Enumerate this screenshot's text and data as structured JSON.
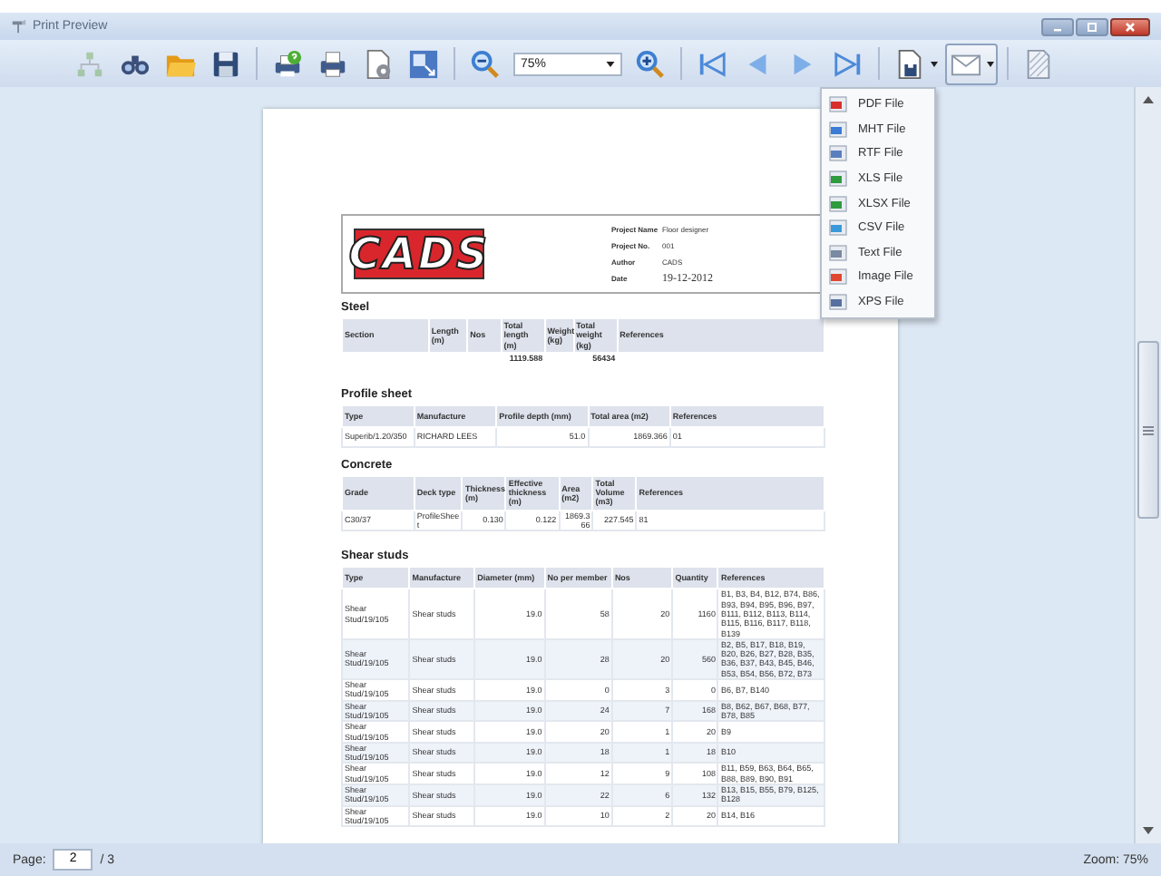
{
  "window": {
    "title": "Print Preview"
  },
  "toolbar": {
    "buttons": [
      {
        "kind": "tree",
        "disabled": true,
        "pressed": false
      },
      {
        "kind": "binoculars",
        "disabled": false,
        "pressed": false
      },
      {
        "kind": "folder",
        "disabled": false,
        "pressed": false
      },
      {
        "kind": "disk",
        "disabled": false,
        "pressed": false
      },
      {
        "kind": "separator"
      },
      {
        "kind": "printer-help",
        "disabled": false,
        "pressed": false
      },
      {
        "kind": "printer",
        "disabled": false,
        "pressed": false
      },
      {
        "kind": "page-gear",
        "disabled": false,
        "pressed": false
      },
      {
        "kind": "resize",
        "disabled": false,
        "pressed": false
      },
      {
        "kind": "separator"
      },
      {
        "kind": "zoom-out",
        "disabled": false,
        "pressed": false
      },
      {
        "kind": "zoom-select",
        "value": "75%"
      },
      {
        "kind": "zoom-in",
        "disabled": false,
        "pressed": false
      },
      {
        "kind": "separator"
      },
      {
        "kind": "first",
        "disabled": false,
        "pressed": false
      },
      {
        "kind": "prev",
        "disabled": false,
        "pressed": false
      },
      {
        "kind": "next",
        "disabled": false,
        "pressed": false
      },
      {
        "kind": "last",
        "disabled": false,
        "pressed": false
      },
      {
        "kind": "separator"
      },
      {
        "kind": "save-page",
        "disabled": false,
        "pressed": false,
        "dropdown": true
      },
      {
        "kind": "envelope",
        "disabled": false,
        "pressed": true,
        "dropdown": true
      },
      {
        "kind": "separator"
      },
      {
        "kind": "watermark",
        "disabled": false,
        "pressed": false
      }
    ]
  },
  "export_menu": [
    {
      "label": "PDF File",
      "kind": "pdf"
    },
    {
      "label": "MHT File",
      "kind": "mht"
    },
    {
      "label": "RTF File",
      "kind": "rtf"
    },
    {
      "label": "XLS File",
      "kind": "xls"
    },
    {
      "label": "XLSX File",
      "kind": "xlsx"
    },
    {
      "label": "CSV File",
      "kind": "csv"
    },
    {
      "label": "Text File",
      "kind": "txt"
    },
    {
      "label": "Image File",
      "kind": "image"
    },
    {
      "label": "XPS File",
      "kind": "xps"
    }
  ],
  "report": {
    "logo": "CADS",
    "info": [
      {
        "label": "Project Name",
        "value": "Floor designer"
      },
      {
        "label": "Project No.",
        "value": "001"
      },
      {
        "label": "Author",
        "value": "CADS"
      },
      {
        "label": "Date",
        "value": "19-12-2012",
        "kind": "date"
      }
    ],
    "sections": [
      {
        "title": "Steel",
        "columns": [
          "Section",
          "Length (m)",
          "Nos",
          "Total length (m)",
          "Weight (kg)",
          "Total weight (kg)",
          "References"
        ],
        "total_row": true,
        "rows": [
          [
            "",
            "",
            "",
            "1119.588",
            "",
            "56434",
            ""
          ]
        ]
      },
      {
        "title": "Profile sheet",
        "columns": [
          "Type",
          "Manufacture",
          "Profile depth (mm)",
          "Total area (m2)",
          "References"
        ],
        "rows": [
          [
            "Superib/1.20/350",
            "RICHARD LEES",
            "51.0",
            "1869.366",
            "01"
          ]
        ]
      },
      {
        "title": "Concrete",
        "columns": [
          "Grade",
          "Deck type",
          "Thickness (m)",
          "Effective thickness (m)",
          "Area (m2)",
          "Total Volume (m3)",
          "References"
        ],
        "rows": [
          [
            "C30/37",
            "ProfileSheet",
            "0.130",
            "0.122",
            "1869.366",
            "227.545",
            "81"
          ]
        ]
      },
      {
        "title": "Shear studs",
        "columns": [
          "Type",
          "Manufacture",
          "Diameter (mm)",
          "No per member",
          "Nos",
          "Quantity",
          "References"
        ],
        "rows": [
          [
            "Shear Stud/19/105",
            "Shear studs",
            "19.0",
            "58",
            "20",
            "1160",
            "B1, B3, B4, B12, B74, B86, B93, B94, B95, B96, B97, B111, B112, B113, B114, B115, B116, B117, B118, B139"
          ],
          [
            "Shear Stud/19/105",
            "Shear studs",
            "19.0",
            "28",
            "20",
            "560",
            "B2, B5, B17, B18, B19, B20, B26, B27, B28, B35, B36, B37, B43, B45, B46, B53, B54, B56, B72, B73"
          ],
          [
            "Shear Stud/19/105",
            "Shear studs",
            "19.0",
            "0",
            "3",
            "0",
            "B6, B7, B140"
          ],
          [
            "Shear Stud/19/105",
            "Shear studs",
            "19.0",
            "24",
            "7",
            "168",
            "B8, B62, B67, B68, B77, B78, B85"
          ],
          [
            "Shear Stud/19/105",
            "Shear studs",
            "19.0",
            "20",
            "1",
            "20",
            "B9"
          ],
          [
            "Shear Stud/19/105",
            "Shear studs",
            "19.0",
            "18",
            "1",
            "18",
            "B10"
          ],
          [
            "Shear Stud/19/105",
            "Shear studs",
            "19.0",
            "12",
            "9",
            "108",
            "B11, B59, B63, B64, B65, B88, B89, B90, B91"
          ],
          [
            "Shear Stud/19/105",
            "Shear studs",
            "19.0",
            "22",
            "6",
            "132",
            "B13, B15, B55, B79, B125, B128"
          ],
          [
            "Shear Stud/19/105",
            "Shear studs",
            "19.0",
            "10",
            "2",
            "20",
            "B14, B16"
          ]
        ]
      }
    ]
  },
  "status_bar": {
    "page_label": "Page:",
    "page": "2",
    "page_total": "/ 3",
    "zoom": "Zoom: 75%"
  }
}
